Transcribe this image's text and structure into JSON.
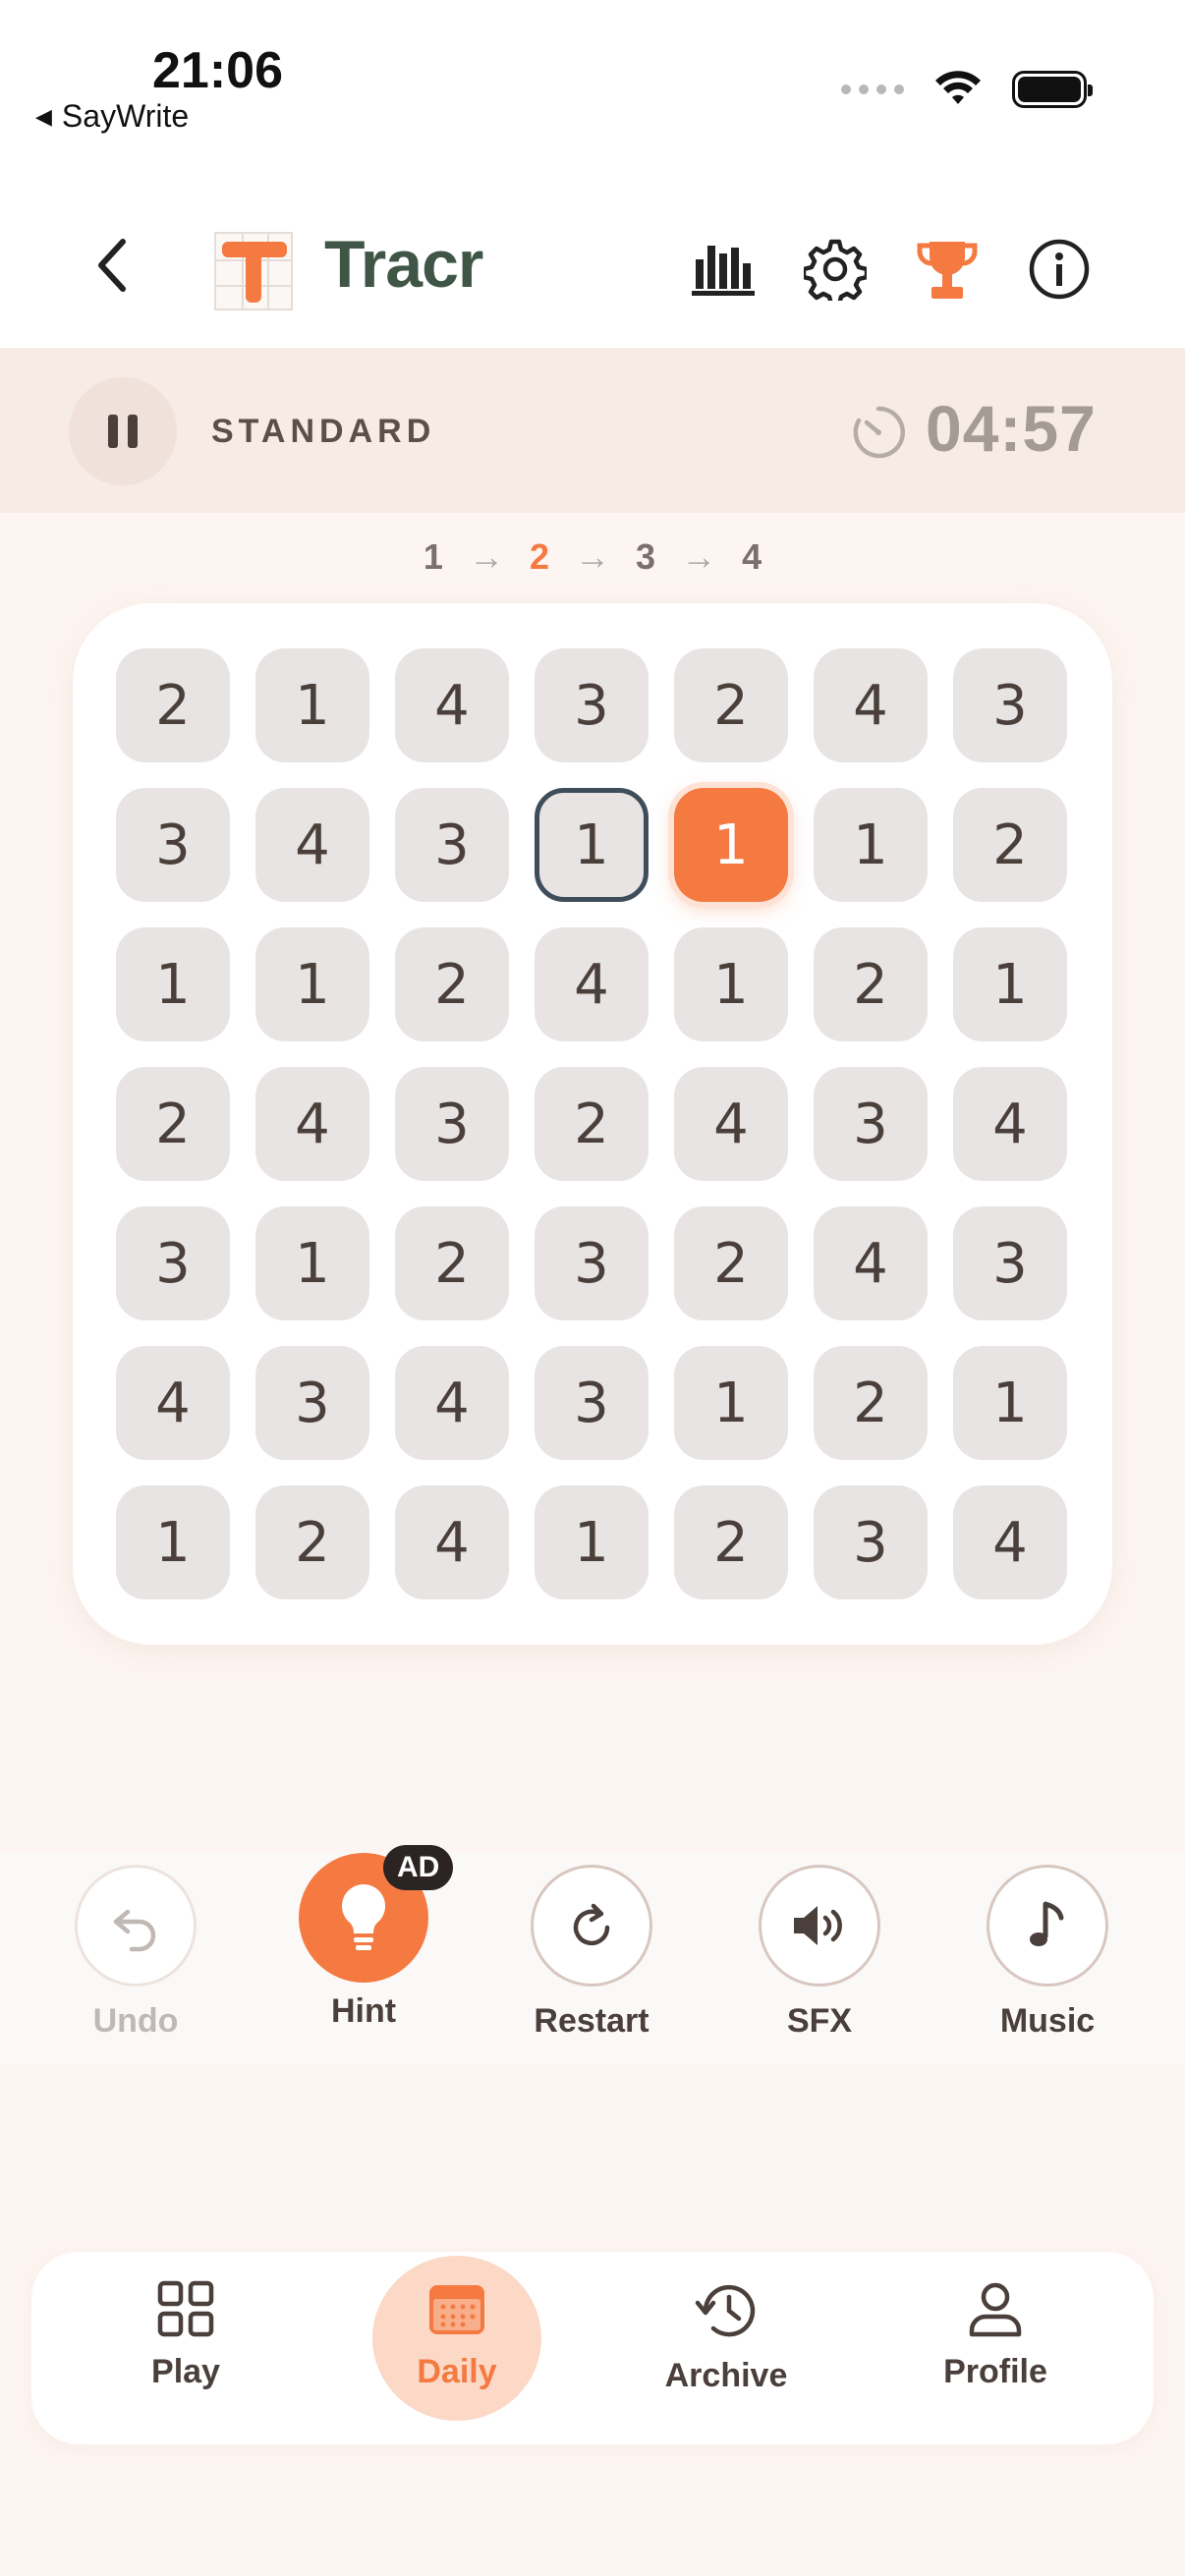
{
  "status_bar": {
    "time": "21:06",
    "back_app": "SayWrite"
  },
  "header": {
    "title": "Tracr",
    "icons": [
      "back-chevron-icon",
      "stats-icon",
      "settings-gear-icon",
      "trophy-icon",
      "info-icon"
    ]
  },
  "mode": {
    "label": "STANDARD",
    "timer": "04:57"
  },
  "sequence": {
    "items": [
      "1",
      "2",
      "3",
      "4"
    ],
    "current_index": 1
  },
  "grid": {
    "rows": [
      [
        "2",
        "1",
        "4",
        "3",
        "2",
        "4",
        "3"
      ],
      [
        "3",
        "4",
        "3",
        "1",
        "1",
        "1",
        "2"
      ],
      [
        "1",
        "1",
        "2",
        "4",
        "1",
        "2",
        "1"
      ],
      [
        "2",
        "4",
        "3",
        "2",
        "4",
        "3",
        "4"
      ],
      [
        "3",
        "1",
        "2",
        "3",
        "2",
        "4",
        "3"
      ],
      [
        "4",
        "3",
        "4",
        "3",
        "1",
        "2",
        "1"
      ],
      [
        "1",
        "2",
        "4",
        "1",
        "2",
        "3",
        "4"
      ]
    ],
    "selected_cell": [
      1,
      3
    ],
    "active_cell": [
      1,
      4
    ]
  },
  "toolbar": {
    "undo": "Undo",
    "hint": "Hint",
    "hint_badge": "AD",
    "restart": "Restart",
    "sfx": "SFX",
    "music": "Music"
  },
  "nav": {
    "play": "Play",
    "daily": "Daily",
    "archive": "Archive",
    "profile": "Profile"
  },
  "colors": {
    "accent": "#f47a42",
    "title": "#3f5646",
    "background": "#fdf5f1"
  }
}
